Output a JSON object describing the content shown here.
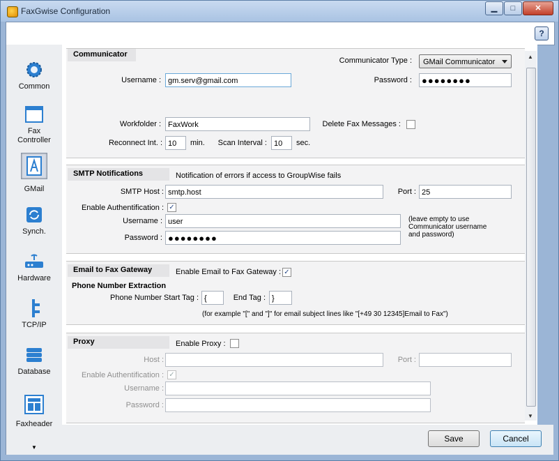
{
  "window": {
    "title": "FaxGwise Configuration"
  },
  "sidebar": {
    "items": [
      {
        "label": "Common",
        "icon": "gear-icon"
      },
      {
        "label": "Fax\nController",
        "icon": "window-icon"
      },
      {
        "label": "GMail",
        "icon": "document-a-icon"
      },
      {
        "label": "Synch.",
        "icon": "sync-icon"
      },
      {
        "label": "Hardware",
        "icon": "modem-icon"
      },
      {
        "label": "TCP/IP",
        "icon": "network-icon"
      },
      {
        "label": "Database",
        "icon": "database-icon"
      },
      {
        "label": "Faxheader",
        "icon": "layout-icon"
      }
    ],
    "selected": "GMail"
  },
  "communicator": {
    "title": "Communicator",
    "type_label": "Communicator Type :",
    "type_value": "GMail Communicator",
    "username_label": "Username :",
    "username_value": "gm.serv@gmail.com",
    "password_label": "Password :",
    "password_value": "●●●●●●●●",
    "workfolder_label": "Workfolder :",
    "workfolder_value": "FaxWork",
    "delete_label": "Delete Fax Messages :",
    "reconnect_label": "Reconnect Int. :",
    "reconnect_value": "10",
    "reconnect_unit": "min.",
    "scan_label": "Scan Interval :",
    "scan_value": "10",
    "scan_unit": "sec."
  },
  "smtp": {
    "title": "SMTP Notifications",
    "description": "Notification of errors if access to GroupWise fails",
    "host_label": "SMTP Host :",
    "host_value": "smtp.host",
    "port_label": "Port :",
    "port_value": "25",
    "auth_label": "Enable Authentification :",
    "username_label": "Username :",
    "username_value": "user",
    "password_label": "Password :",
    "password_value": "●●●●●●●●",
    "hint_line1": "(leave empty to use",
    "hint_line2": "Communicator username",
    "hint_line3": "and password)"
  },
  "gateway": {
    "title": "Email to Fax Gateway",
    "enable_label": "Enable Email to Fax Gateway :",
    "extraction_title": "Phone Number Extraction",
    "start_label": "Phone Number Start Tag :",
    "start_value": "{",
    "end_label": "End Tag :",
    "end_value": "}",
    "example": "(for example \"[\" and \"]\" for email subject lines like \"[+49 30 12345]Email to Fax\")"
  },
  "proxy": {
    "title": "Proxy",
    "enable_label": "Enable Proxy :",
    "host_label": "Host :",
    "port_label": "Port :",
    "auth_label": "Enable Authentification :",
    "username_label": "Username :",
    "password_label": "Password :"
  },
  "footer": {
    "save_label": "Save",
    "cancel_label": "Cancel"
  },
  "help_label": "?"
}
